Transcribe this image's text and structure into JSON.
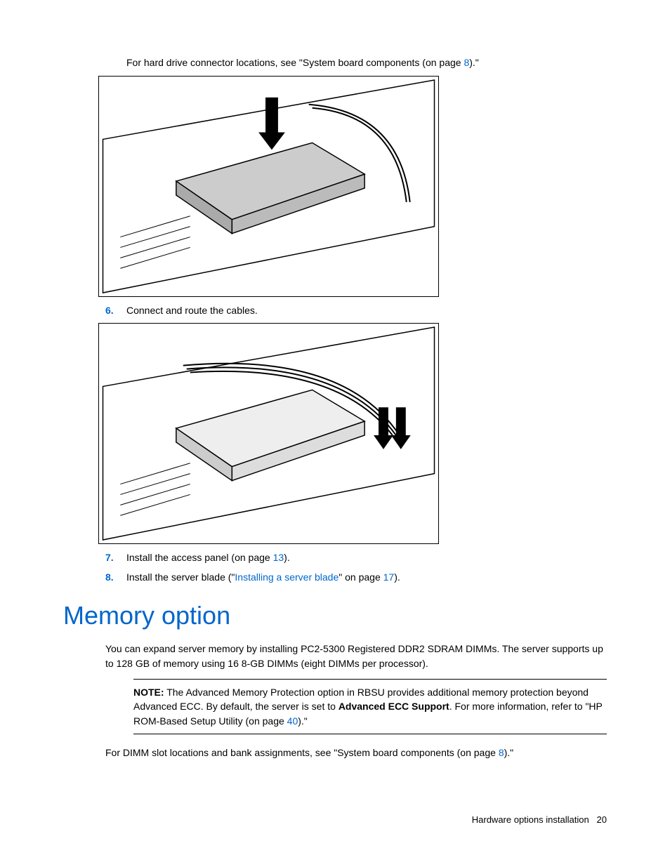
{
  "intro": {
    "pre": "For hard drive connector locations, see \"System board components (on page ",
    "link": "8",
    "post": ").\""
  },
  "step6": {
    "num": "6.",
    "text": "Connect and route the cables."
  },
  "step7": {
    "num": "7.",
    "pre": "Install the access panel (on page ",
    "link": "13",
    "post": ")."
  },
  "step8": {
    "num": "8.",
    "pre": "Install the server blade (\"",
    "linktext": "Installing a server blade",
    "mid": "\" on page ",
    "linkpage": "17",
    "post": ")."
  },
  "heading": "Memory option",
  "para1": "You can expand server memory by installing PC2-5300 Registered DDR2 SDRAM DIMMs. The server supports up to 128 GB of memory using 16 8-GB DIMMs (eight DIMMs per processor).",
  "note": {
    "label": "NOTE:",
    "pre": "  The Advanced Memory Protection option in RBSU provides additional memory protection beyond Advanced ECC. By default, the server is set to ",
    "bold": "Advanced ECC Support",
    "mid": ". For more information, refer to \"HP ROM-Based Setup Utility (on page ",
    "link": "40",
    "post": ").\""
  },
  "para2": {
    "pre": "For DIMM slot locations and bank assignments, see \"System board components (on page ",
    "link": "8",
    "post": ").\""
  },
  "footer": {
    "section": "Hardware options installation",
    "page": "20"
  }
}
